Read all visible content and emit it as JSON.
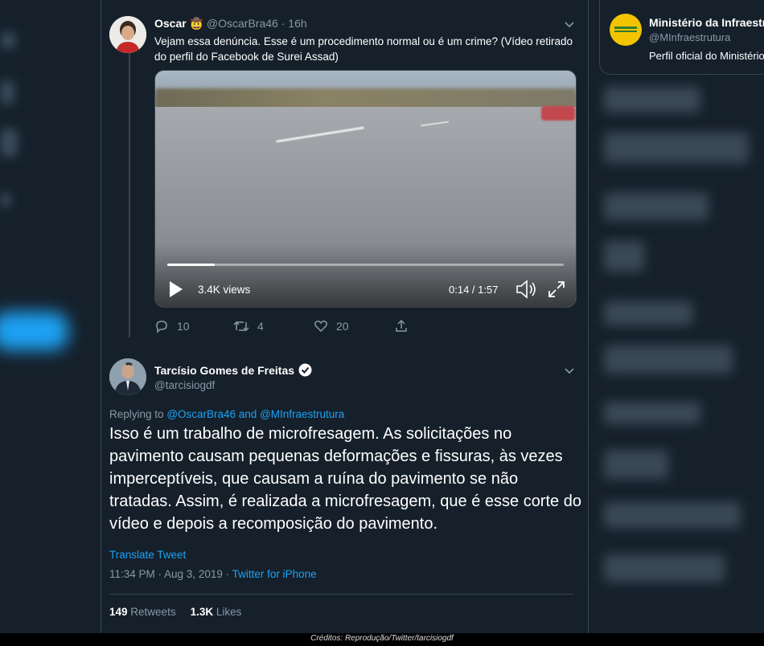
{
  "tweet1": {
    "name": "Oscar",
    "emoji": "🤠",
    "handle": "@OscarBra46",
    "time": "· 16h",
    "text": "Vejam essa denúncia. Esse é um procedimento normal ou é um crime? (Vídeo retirado do perfil do Facebook de Surei Assad)",
    "video": {
      "views": "3.4K views",
      "time": "0:14 / 1:57",
      "progress": 0.12
    },
    "actions": {
      "replies": "10",
      "retweets": "4",
      "likes": "20"
    }
  },
  "tweet2": {
    "name": "Tarcísio Gomes de Freitas",
    "handle": "@tarcisiogdf",
    "replying_prefix": "Replying to",
    "replying_users": "@OscarBra46 and @MInfraestrutura",
    "body": "Isso é um trabalho de microfresagem. As solicitações no pavimento causam pequenas deformações e fissuras, às vezes imperceptíveis, que causam a ruína do pavimento se não tratadas. Assim, é realizada a microfresagem, que é esse corte do vídeo e depois a recomposição do pavimento.",
    "translate": "Translate Tweet",
    "timestamp": "11:34 PM · Aug 3, 2019 ·",
    "source": "Twitter for iPhone",
    "retweets_count": "149",
    "retweets_label": "Retweets",
    "likes_count": "1.3K",
    "likes_label": "Likes"
  },
  "right_card": {
    "name": "Ministério da Infraestrutura",
    "handle": "@MInfraestrutura",
    "bio": "Perfil oficial do Ministério"
  },
  "caption": "Créditos: Reprodução/Twitter/tarcisiogdf",
  "colors": {
    "background": "#15202b",
    "border": "#38444d",
    "muted": "#8899a6",
    "accent": "#1da1f2"
  }
}
